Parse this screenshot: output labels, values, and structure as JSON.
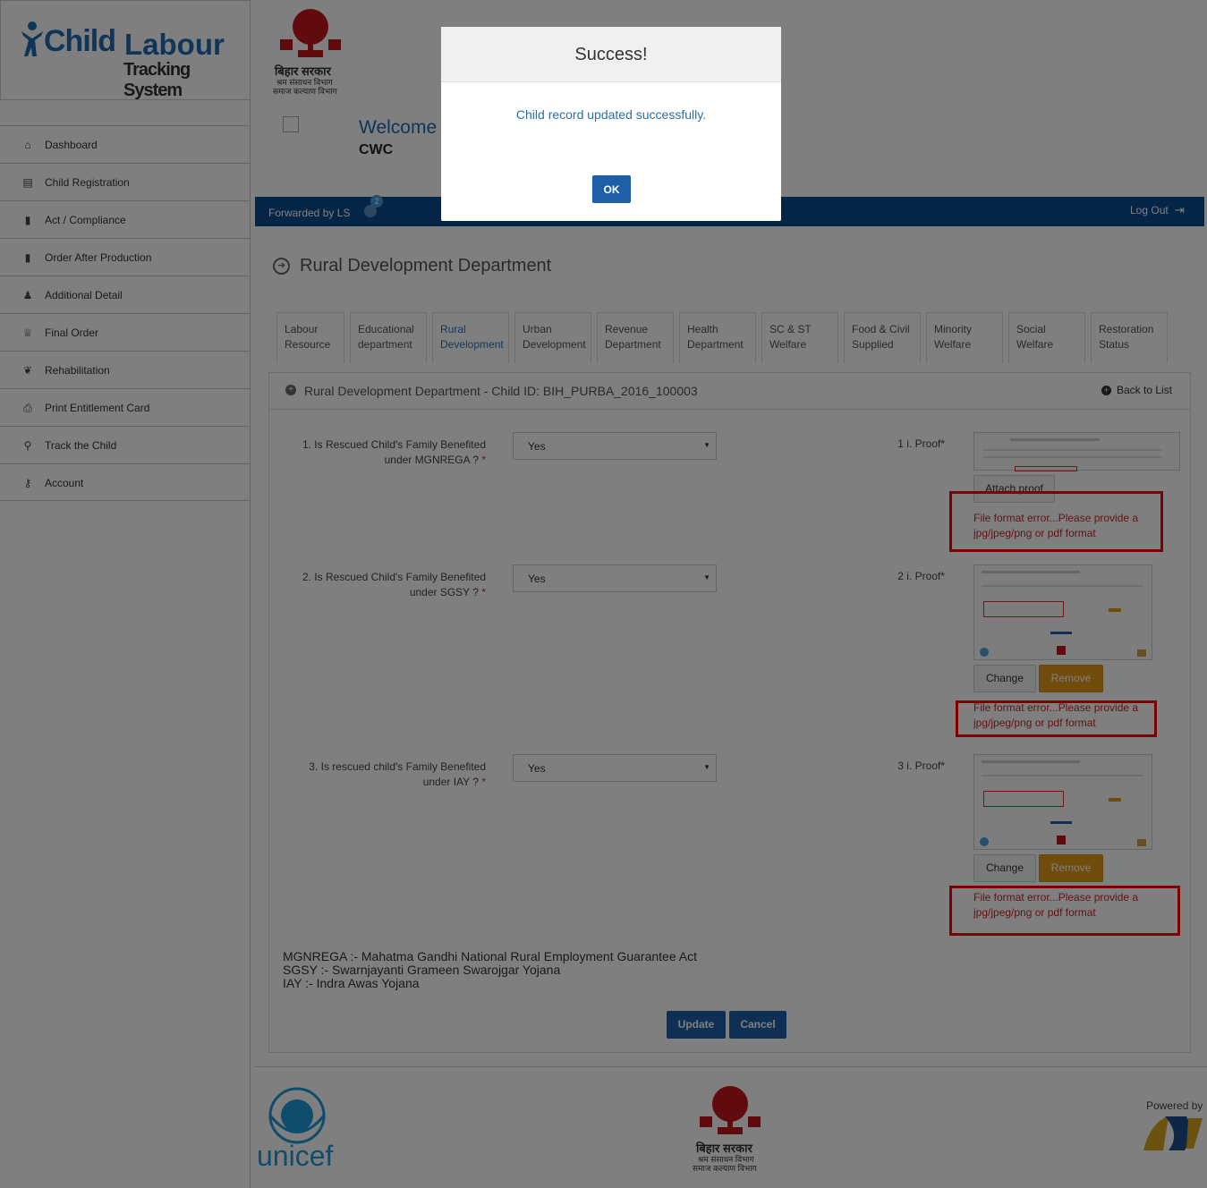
{
  "brand": {
    "logo_child": "Child",
    "logo_labour": "Labour",
    "logo_tagline": "Tracking System",
    "bihar_title": "बिहार सरकार",
    "bihar_dept1": "श्रम संसाधन विभाग",
    "bihar_dept2": "समाज कल्याण विभाग"
  },
  "sidebar": {
    "items": [
      {
        "label": "Dashboard",
        "icon": "home-icon"
      },
      {
        "label": "Child Registration",
        "icon": "id-card-icon"
      },
      {
        "label": "Act / Compliance",
        "icon": "book-icon"
      },
      {
        "label": "Order After Production",
        "icon": "clipboard-icon"
      },
      {
        "label": "Additional Detail",
        "icon": "user-plus-icon"
      },
      {
        "label": "Final Order",
        "icon": "trophy-icon"
      },
      {
        "label": "Rehabilitation",
        "icon": "leaf-icon"
      },
      {
        "label": "Print Entitlement Card",
        "icon": "print-icon"
      },
      {
        "label": "Track the Child",
        "icon": "search-icon"
      },
      {
        "label": "Account",
        "icon": "key-icon"
      }
    ]
  },
  "header": {
    "welcome": "Welcome",
    "user": "CWC",
    "forwarded": "Forwarded by LS",
    "notif_count": "2",
    "logout": "Log Out"
  },
  "page": {
    "title": "Rural Development Department"
  },
  "tabs": [
    {
      "line1": "Labour",
      "line2": "Resource"
    },
    {
      "line1": "Educational",
      "line2": "department"
    },
    {
      "line1": "Rural",
      "line2": "Development"
    },
    {
      "line1": "Urban",
      "line2": "Development"
    },
    {
      "line1": "Revenue",
      "line2": "Department"
    },
    {
      "line1": "Health",
      "line2": "Department"
    },
    {
      "line1": "SC & ST",
      "line2": "Welfare"
    },
    {
      "line1": "Food & Civil",
      "line2": "Supplied"
    },
    {
      "line1": "Minority",
      "line2": "Welfare"
    },
    {
      "line1": "Social",
      "line2": "Welfare"
    },
    {
      "line1": "Restoration",
      "line2": "Status"
    }
  ],
  "panel": {
    "heading": "Rural Development Department - Child ID: BIH_PURBA_2016_100003",
    "back": "Back to List"
  },
  "questions": [
    {
      "line1": "1. Is Rescued Child's Family Benefited",
      "line2": "under MGNREGA ?",
      "value": "Yes",
      "proof": "1 i. Proof*"
    },
    {
      "line1": "2. Is Rescued Child's Family Benefited",
      "line2": "under SGSY ?",
      "value": "Yes",
      "proof": "2 i. Proof*"
    },
    {
      "line1": "3. Is rescued child's Family Benefited",
      "line2": "under IAY ?",
      "value": "Yes",
      "proof": "3 i. Proof*"
    }
  ],
  "errors": {
    "line1": "File format error...Please provide a",
    "line2": "jpg/jpeg/png or pdf format"
  },
  "buttons": {
    "attach": "Attach proof",
    "change": "Change",
    "remove": "Remove",
    "update": "Update",
    "cancel": "Cancel"
  },
  "footnotes": [
    "MGNREGA :- Mahatma Gandhi National Rural Employment Guarantee Act",
    "SGSY :- Swarnjayanti Grameen Swarojgar Yojana",
    "IAY :- Indra Awas Yojana"
  ],
  "footer": {
    "unicef": "unicef",
    "powered": "Powered by"
  },
  "modal": {
    "title": "Success!",
    "message": "Child record updated successfully.",
    "ok": "OK"
  },
  "colors": {
    "brand_blue": "#0b4a8c",
    "link_blue": "#2672b8",
    "error_red": "#c0282d",
    "highlight_red": "#ff0000",
    "orange": "#e0981a"
  }
}
